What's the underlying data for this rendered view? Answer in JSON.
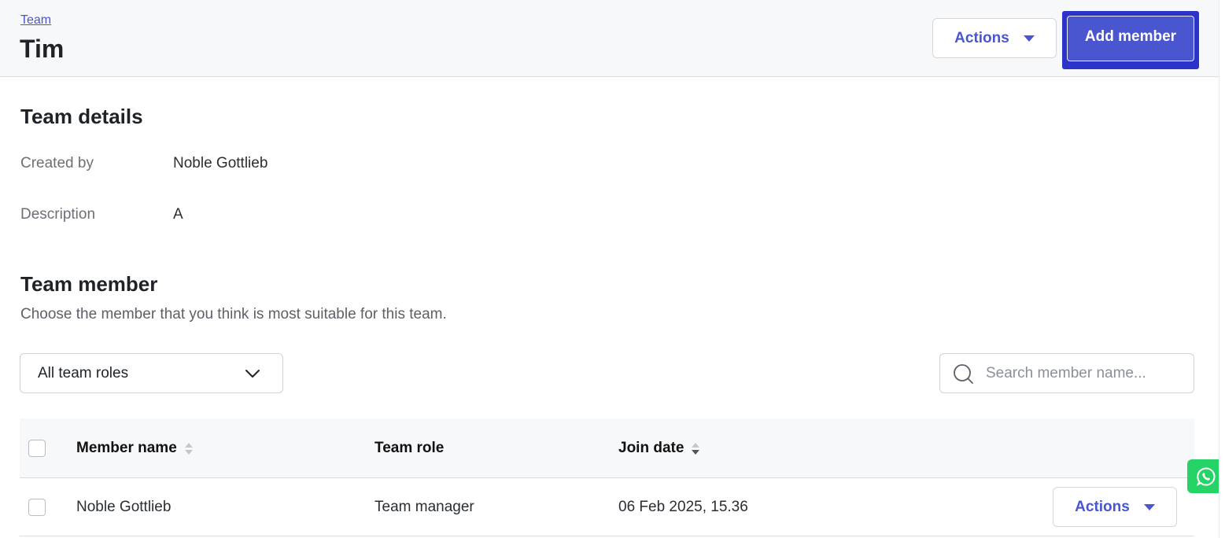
{
  "header": {
    "breadcrumb": "Team",
    "title": "Tim",
    "actions_label": "Actions",
    "add_member_label": "Add member"
  },
  "details": {
    "title": "Team details",
    "rows": [
      {
        "label": "Created by",
        "value": "Noble Gottlieb"
      },
      {
        "label": "Description",
        "value": "A"
      }
    ]
  },
  "members": {
    "title": "Team member",
    "description": "Choose the member that you think is most suitable for this team.",
    "role_filter": {
      "selected": "All team roles"
    },
    "search": {
      "placeholder": "Search member name...",
      "value": ""
    },
    "columns": [
      "Member name",
      "Team role",
      "Join date"
    ],
    "rows": [
      {
        "name": "Noble Gottlieb",
        "role": "Team manager",
        "join_date": "06 Feb 2025, 15.36",
        "actions_label": "Actions"
      }
    ]
  },
  "icons": {
    "chevron": "chevron-down-icon",
    "search": "search-icon",
    "whatsapp": "whatsapp-icon"
  },
  "colors": {
    "primary": "#4a55d0",
    "focus_ring": "#2c33c9",
    "whatsapp": "#25d366"
  }
}
